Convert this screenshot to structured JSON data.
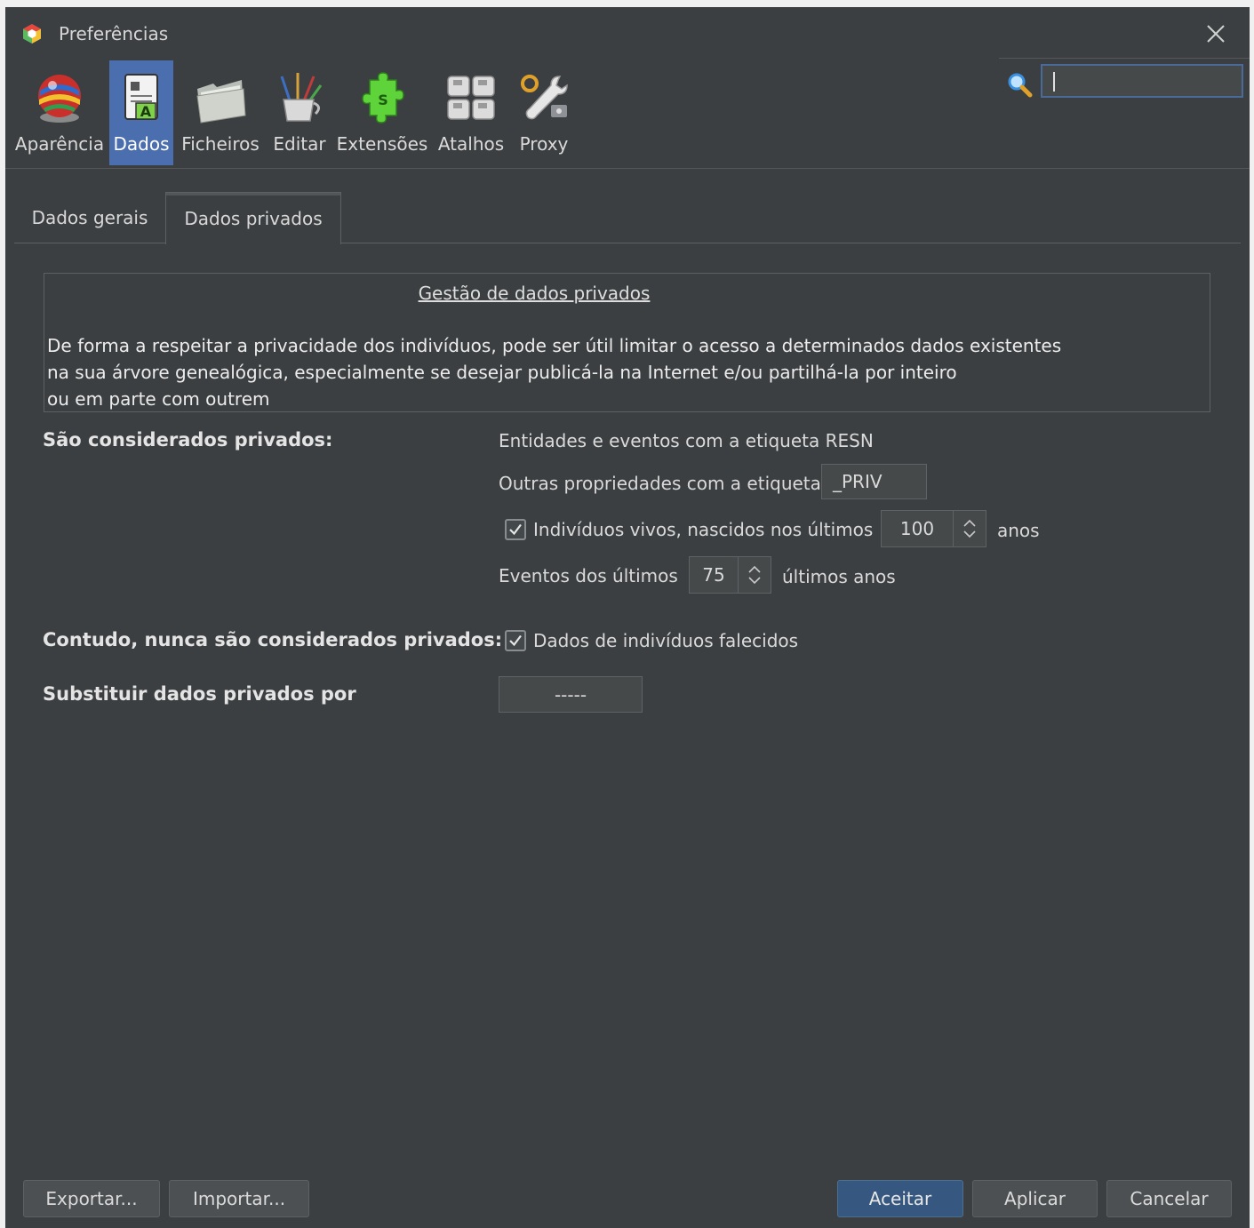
{
  "window": {
    "title": "Preferências"
  },
  "categories": [
    {
      "label": "Aparência",
      "icon": "globe-flags-icon"
    },
    {
      "label": "Dados",
      "icon": "data-document-icon",
      "active": true
    },
    {
      "label": "Ficheiros",
      "icon": "folder-icon"
    },
    {
      "label": "Editar",
      "icon": "brushes-cup-icon"
    },
    {
      "label": "Extensões",
      "icon": "puzzle-piece-icon"
    },
    {
      "label": "Atalhos",
      "icon": "keyboard-keys-icon"
    },
    {
      "label": "Proxy",
      "icon": "wrench-gear-icon"
    }
  ],
  "search": {
    "value": "",
    "icon": "search-icon"
  },
  "tabs": [
    {
      "label": "Dados gerais"
    },
    {
      "label": "Dados privados",
      "active": true
    }
  ],
  "info": {
    "title": "Gestão de dados privados",
    "lines": [
      "De forma a respeitar a privacidade dos indivíduos, pode ser útil limitar o acesso a determinados dados existentes",
      "na sua árvore genealógica, especialmente se desejar publicá-la na Internet e/ou partilhá-la por inteiro",
      "ou em parte com outrem"
    ]
  },
  "private": {
    "heading": "São considerados privados:",
    "resn_text": "Entidades e eventos com a etiqueta RESN",
    "tag_label": "Outras propriedades com a etiqueta",
    "tag_value": "_PRIV",
    "living_checked": true,
    "living_label": "Indivíduos vivos, nascidos nos últimos",
    "living_years": "100",
    "living_unit": "anos",
    "events_label": "Eventos dos últimos",
    "events_years": "75",
    "events_unit": "últimos anos"
  },
  "never_private": {
    "heading": "Contudo, nunca são considerados privados:",
    "deceased_checked": true,
    "deceased_label": "Dados de indivíduos falecidos"
  },
  "replace": {
    "heading": "Substituir dados privados por",
    "value": "-----"
  },
  "buttons": {
    "export": "Exportar...",
    "import": "Importar...",
    "accept": "Aceitar",
    "apply": "Aplicar",
    "cancel": "Cancelar"
  },
  "colors": {
    "background": "#3c3f41",
    "selected": "#4b6eaf",
    "primary_button": "#365880"
  }
}
